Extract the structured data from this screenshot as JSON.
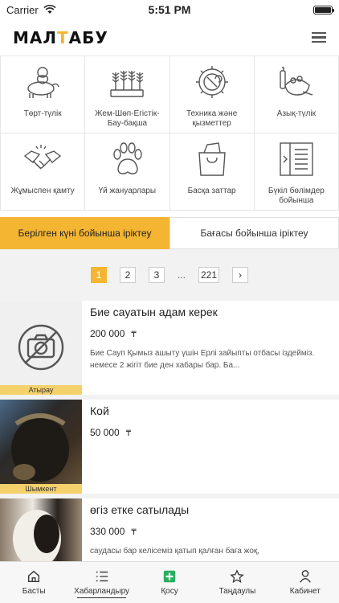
{
  "status": {
    "carrier": "Carrier",
    "time": "5:51 PM"
  },
  "header": {
    "logo_part1": "МАЛ",
    "logo_accent": "Т",
    "logo_part2": "АБУ"
  },
  "categories": [
    {
      "label": "Төрт-түлік",
      "icon": "cow-icon"
    },
    {
      "label": "Жем-Шөп-Егістік-Бау-бақша",
      "icon": "crops-icon"
    },
    {
      "label": "Техника және қызметтер",
      "icon": "gear-wrench-icon"
    },
    {
      "label": "Азық-түлік",
      "icon": "groceries-icon"
    },
    {
      "label": "Жұмыспен қамту",
      "icon": "handshake-icon"
    },
    {
      "label": "Үй жануарлары",
      "icon": "paw-icon"
    },
    {
      "label": "Басқа заттар",
      "icon": "shopping-bag-icon"
    },
    {
      "label": "Бүкіл бөлімдер бойынша",
      "icon": "list-panel-icon"
    }
  ],
  "sort": {
    "by_date": "Берілген күні бойынша іріктеу",
    "by_price": "Бағасы бойынша іріктеу"
  },
  "pager": {
    "p1": "1",
    "p2": "2",
    "p3": "3",
    "dots": "...",
    "last": "221",
    "next": "›"
  },
  "listings": [
    {
      "title": "Бие сауатын адам керек",
      "price": "200 000",
      "currency": "₸",
      "desc": "Бие Сауп Қымыз ашыту үшін Ерлі зайыпты отбасы іздейміз. немесе 2 жігіт бие ден хабары бар. Ба...",
      "city": "Атырау"
    },
    {
      "title": "Кой",
      "price": "50 000",
      "currency": "₸",
      "desc": "",
      "city": "Шымкент"
    },
    {
      "title": "өгіз етке сатылады",
      "price": "330 000",
      "currency": "₸",
      "desc": "саудасы бар келісеміз қатып қалған баға жоқ,",
      "city": ""
    }
  ],
  "tabs": {
    "home": "Басты",
    "listings": "Хабарландыру",
    "add": "Қосу",
    "favorites": "Таңдаулы",
    "cabinet": "Кабинет"
  },
  "colors": {
    "accent": "#f4b533",
    "add_green": "#27ae60"
  }
}
